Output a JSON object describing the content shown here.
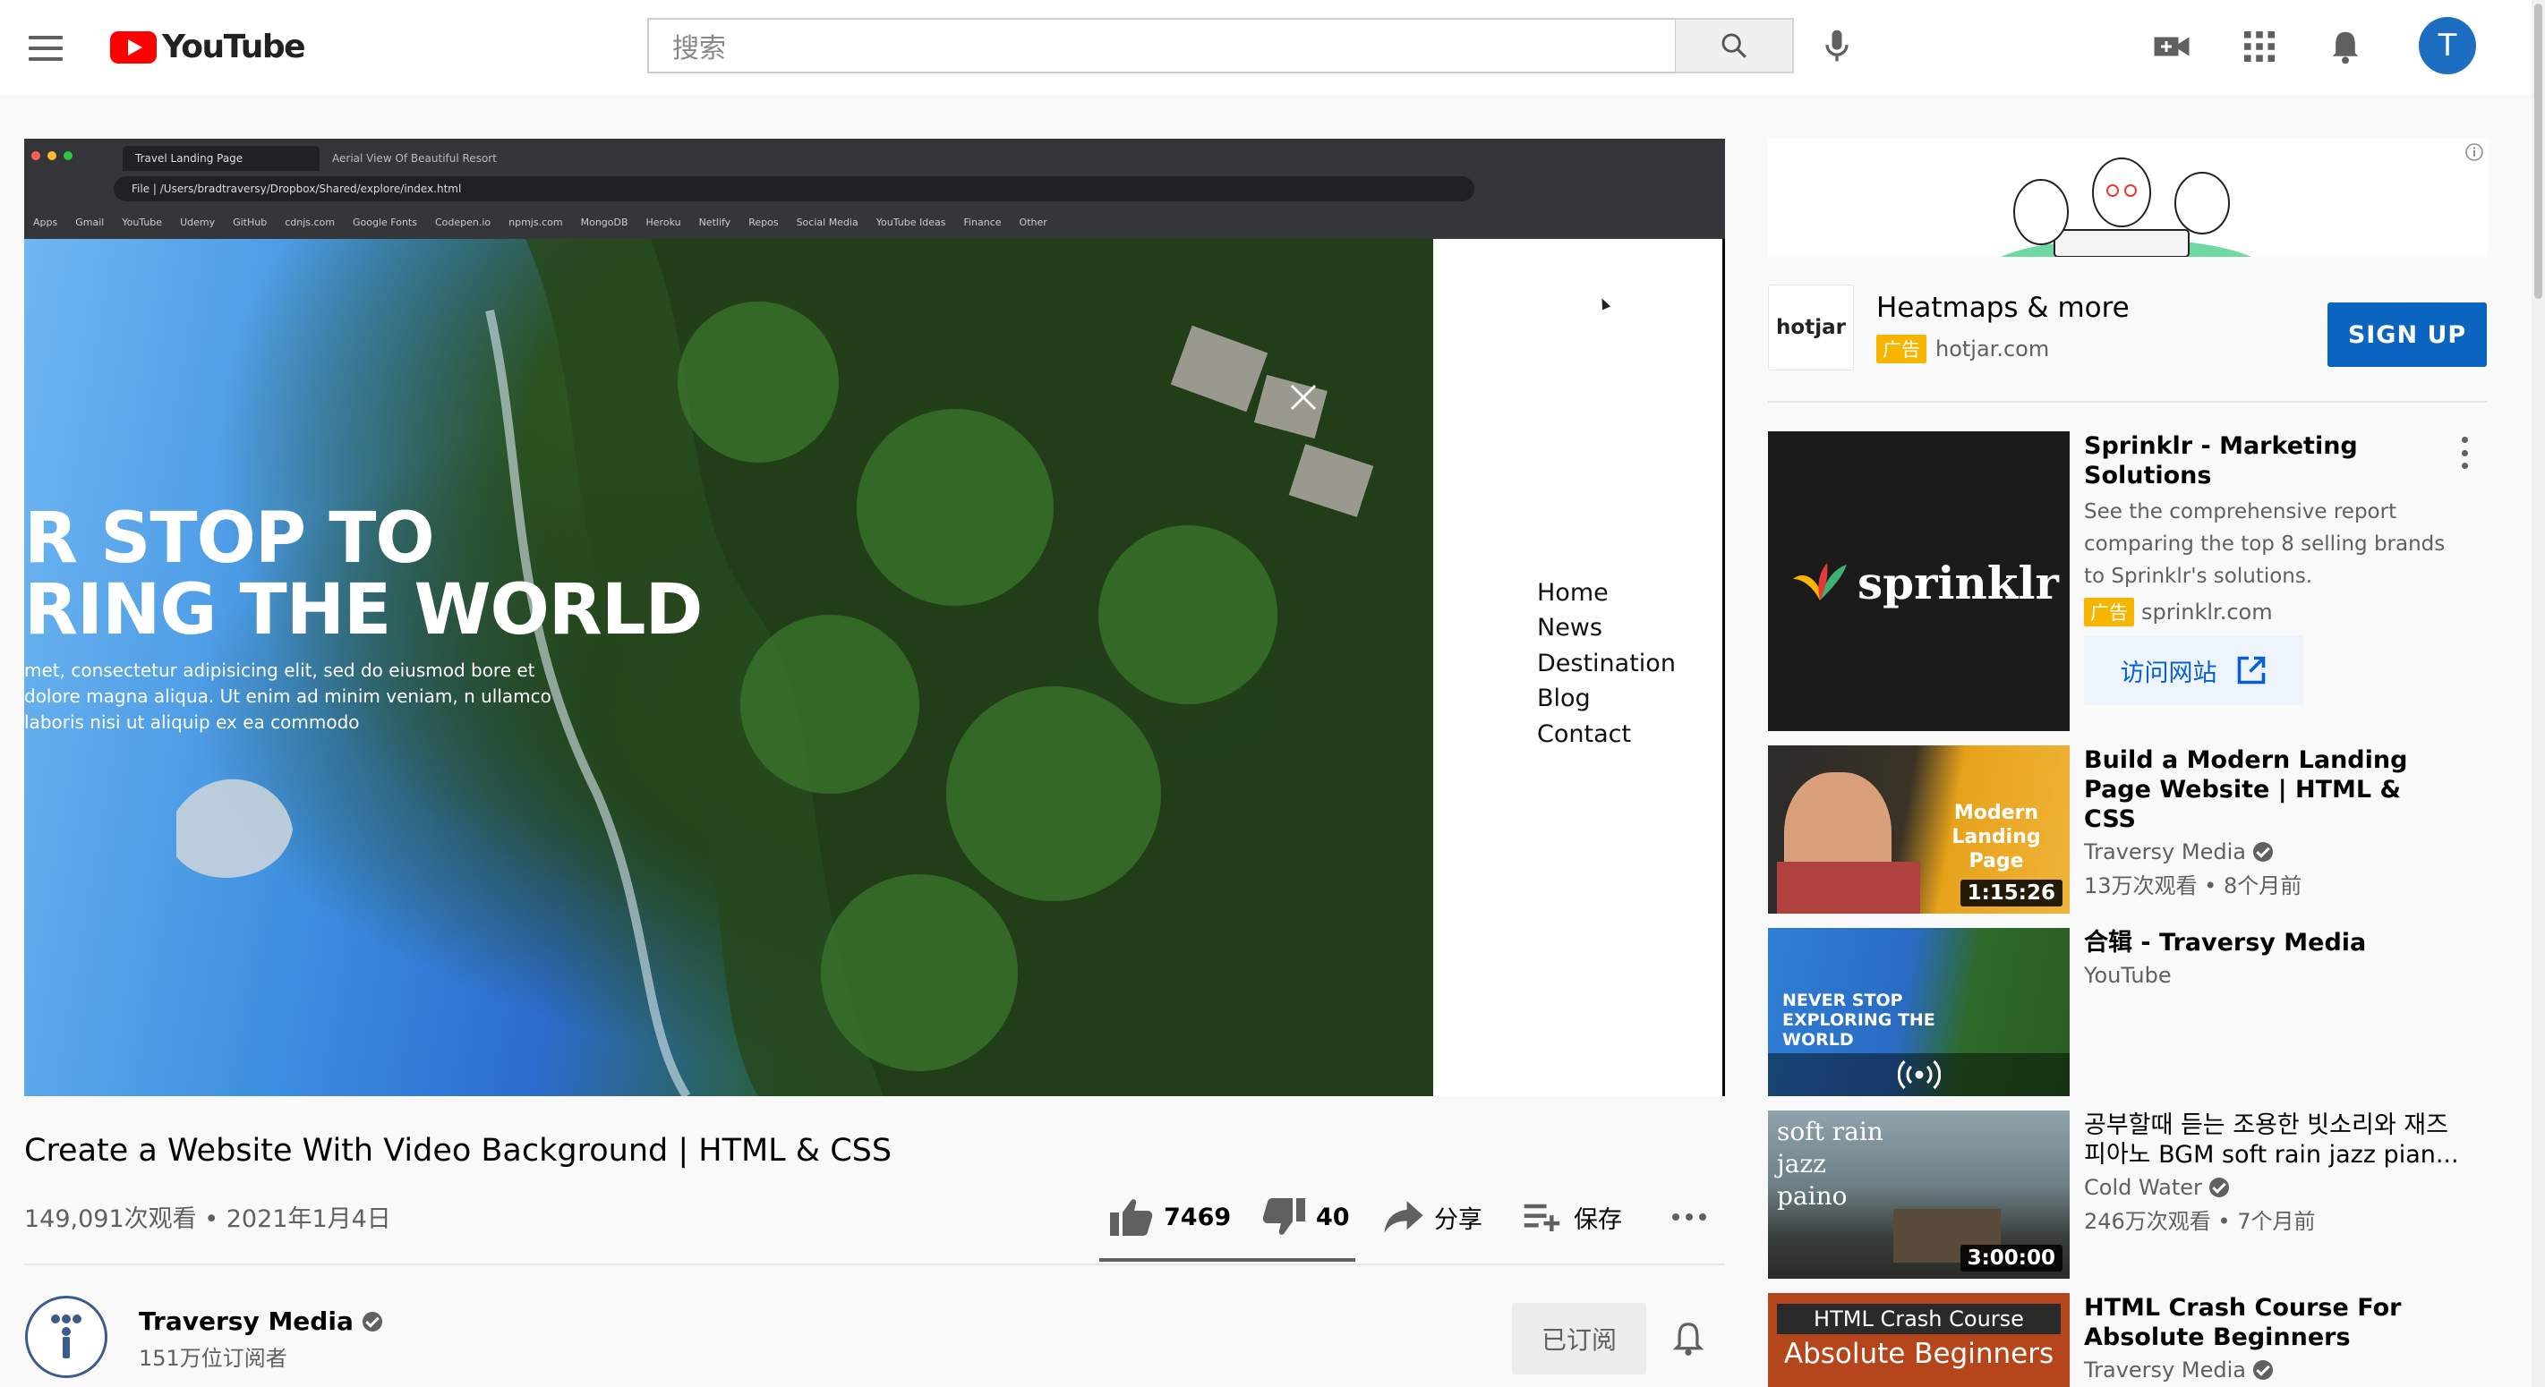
{
  "header": {
    "logo_text": "YouTube",
    "search_placeholder": "搜索",
    "avatar_initial": "T"
  },
  "player": {
    "browser": {
      "tabs": [
        "Travel Landing Page",
        "Aerial View Of Beautiful Resort"
      ],
      "url": "File  |  /Users/bradtraversy/Dropbox/Shared/explore/index.html",
      "bookmarks": [
        "Apps",
        "Gmail",
        "YouTube",
        "Udemy",
        "GitHub",
        "cdnjs.com",
        "Google Fonts",
        "Codepen.io",
        "npmjs.com",
        "MongoDB",
        "Heroku",
        "Netlify",
        "Repos",
        "Social Media",
        "YouTube Ideas",
        "Finance",
        "Other"
      ]
    },
    "hero": {
      "line1": "R STOP TO",
      "line2": "RING THE WORLD",
      "paragraph": "met, consectetur adipisicing elit, sed do eiusmod bore et dolore magna aliqua. Ut enim ad minim veniam, n ullamco laboris nisi ut aliquip ex ea commodo"
    },
    "menu": [
      "Home",
      "News",
      "Destination",
      "Blog",
      "Contact"
    ]
  },
  "video": {
    "title": "Create a Website With Video Background | HTML & CSS",
    "stats": "149,091次观看 • 2021年1月4日",
    "likes": "7469",
    "dislikes": "40",
    "share_label": "分享",
    "save_label": "保存"
  },
  "channel": {
    "name": "Traversy Media",
    "subscribers": "151万位订阅者",
    "subscribed_label": "已订阅"
  },
  "ad": {
    "title": "Heatmaps & more",
    "badge": "广告",
    "domain": "hotjar.com",
    "logo_text": "hotjar",
    "cta": "SIGN UP"
  },
  "recommendations": [
    {
      "title": "Sprinklr - Marketing Solutions",
      "description": "See the comprehensive report comparing the top 8 selling brands to Sprinklr's solutions.",
      "badge": "广告",
      "domain": "sprinklr.com",
      "visit_label": "访问网站",
      "thumb_text": "sprinklr"
    },
    {
      "title": "Build a Modern Landing Page Website | HTML & CSS",
      "channel": "Traversy Media",
      "meta": "13万次观看 • 8个月前",
      "duration": "1:15:26",
      "thumb_text": "Modern Landing Page"
    },
    {
      "title": "合辑 - Traversy Media",
      "channel": "YouTube",
      "thumb_text": "NEVER STOP EXPLORING THE WORLD"
    },
    {
      "title": "공부할때 듣는 조용한 빗소리와 재즈 피아노 BGM soft rain jazz pian...",
      "channel": "Cold Water",
      "meta": "246万次观看 • 7个月前",
      "duration": "3:00:00",
      "thumb_text": "soft rain jazz paino"
    },
    {
      "title": "HTML Crash Course For Absolute Beginners",
      "channel": "Traversy Media",
      "thumb_line1": "HTML Crash Course",
      "thumb_line2": "Absolute Beginners"
    }
  ]
}
